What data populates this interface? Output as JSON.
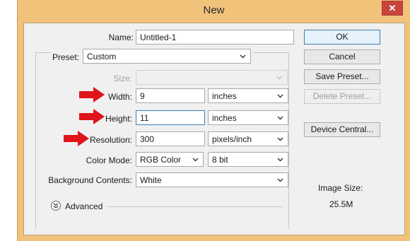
{
  "window": {
    "title": "New",
    "close_glyph": "✕"
  },
  "form": {
    "name": {
      "label": "Name:",
      "value": "Untitled-1"
    },
    "preset": {
      "label": "Preset:",
      "value": "Custom"
    },
    "size": {
      "label": "Size:",
      "value": ""
    },
    "width": {
      "label": "Width:",
      "value": "9",
      "unit": "inches"
    },
    "height": {
      "label": "Height:",
      "value": "11",
      "unit": "inches"
    },
    "resolution": {
      "label": "Resolution:",
      "value": "300",
      "unit": "pixels/inch"
    },
    "color_mode": {
      "label": "Color Mode:",
      "value": "RGB Color",
      "bit_depth": "8 bit"
    },
    "background": {
      "label": "Background Contents:",
      "value": "White"
    },
    "advanced": {
      "label": "Advanced"
    }
  },
  "buttons": {
    "ok": "OK",
    "cancel": "Cancel",
    "save_preset": "Save Preset...",
    "delete_preset": "Delete Preset...",
    "device_central": "Device Central..."
  },
  "image_size": {
    "label": "Image Size:",
    "value": "25.5M"
  },
  "colors": {
    "title_bar": "#f0c27a",
    "arrow": "#e0141b",
    "focus": "#3c7fb1"
  },
  "icons": {
    "dropdown": "chevron-down-icon",
    "annotation": "red-arrow-icon",
    "advanced": "double-chevron-down-icon"
  }
}
